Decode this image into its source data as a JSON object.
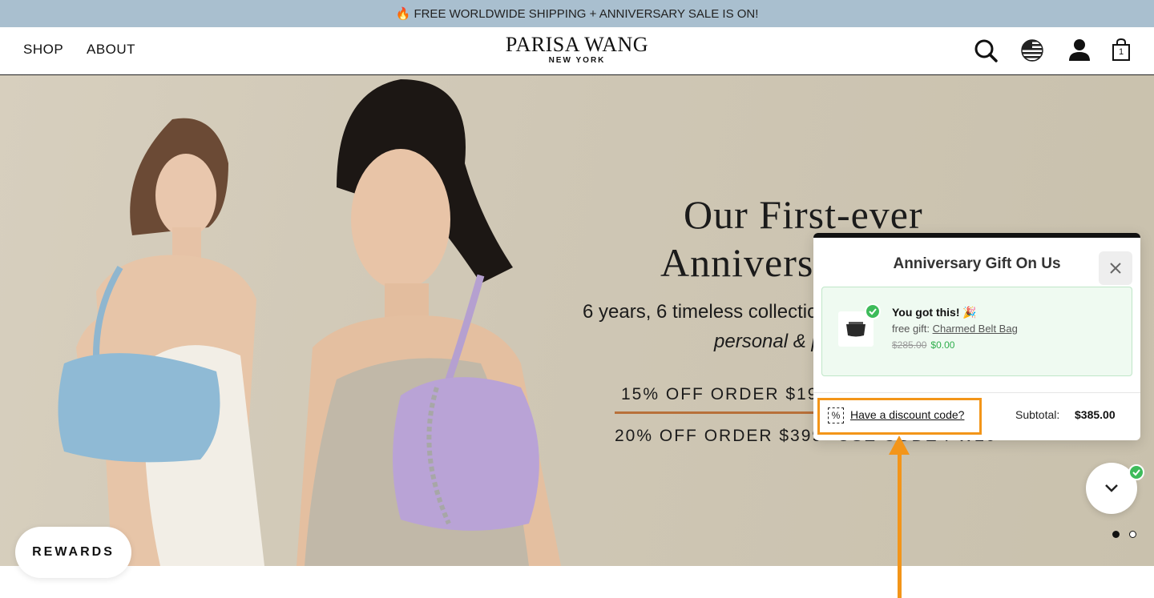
{
  "announcement": {
    "icon": "fire-icon",
    "text": "🔥 FREE WORLDWIDE SHIPPING + ANNIVERSARY SALE IS ON!"
  },
  "header": {
    "nav": [
      {
        "label": "SHOP"
      },
      {
        "label": "ABOUT"
      }
    ],
    "logo": {
      "main": "PARISA WANG",
      "sub": "NEW YORK"
    },
    "icons": {
      "search": "search-icon",
      "region": "us-flag-icon",
      "account": "user-icon",
      "cart": "shopping-bag-icon"
    },
    "cart_count": "1"
  },
  "hero": {
    "title_line1": "Our First-ever",
    "title_line2": "Annivers",
    "subtitle_line1": "6 years, 6 timeless collection",
    "subtitle_line2": "personal & p",
    "offer1": "15% OFF ORDER $199",
    "offer2": "20% OFF ORDER $399",
    "offer2_tail": "USE CODE PW20"
  },
  "rewards": {
    "label": "REWARDS"
  },
  "popup": {
    "title": "Anniversary Gift On Us",
    "gift": {
      "headline": "You got this! 🎉",
      "prefix": "free gift: ",
      "name": "Charmed Belt Bag",
      "old_price": "$285.00",
      "new_price": "$0.00"
    },
    "discount_link": "Have a discount code?",
    "subtotal_label": "Subtotal:",
    "subtotal_value": "$385.00"
  },
  "colors": {
    "announce_bg": "#a9bfcf",
    "accent": "#f39519",
    "success": "#3dbb5a",
    "offer_underline": "#b8703a"
  }
}
